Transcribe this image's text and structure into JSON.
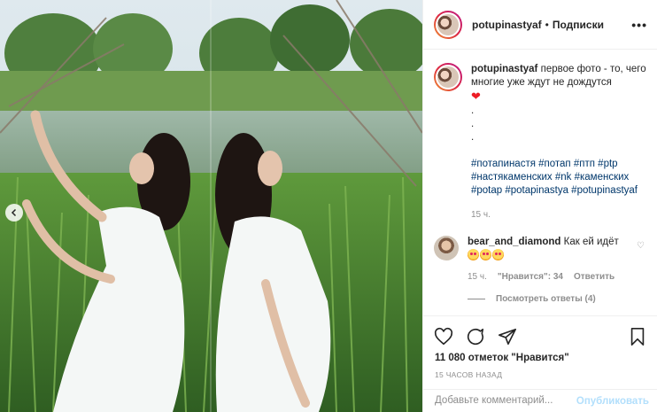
{
  "post": {
    "username": "potupinastyaf",
    "follow_label": "Подписки",
    "separator": "•"
  },
  "caption": {
    "username": "potupinastyaf",
    "text": "первое фото - то, чего многие уже ждут не дождутся",
    "dots": [
      ".",
      ".",
      "."
    ],
    "hashtags": "#потапинастя #потап #птп #ptp #настякаменских #nk #каменских #potap #potapinastya #potupinastyaf",
    "time": "15 ч."
  },
  "comment": {
    "username": "bear_and_diamond",
    "text": "Как ей идёт",
    "time": "15 ч.",
    "likes": "\"Нравится\": 34",
    "reply_label": "Ответить",
    "view_replies": "Посмотреть ответы (4)"
  },
  "stats": {
    "likes": "11 080 отметок \"Нравится\"",
    "ago": "15 ЧАСОВ НАЗАД"
  },
  "add_comment": {
    "placeholder": "Добавьте комментарий...",
    "publish_label": "Опубликовать"
  },
  "colors": {
    "link": "#00376b",
    "muted": "#8e8e8e",
    "publish_disabled": "#b2dffc",
    "heart": "#ed1c24"
  },
  "icons": [
    "chevron-left-icon",
    "more-icon",
    "heart-icon",
    "comment-icon",
    "share-icon",
    "bookmark-icon"
  ]
}
